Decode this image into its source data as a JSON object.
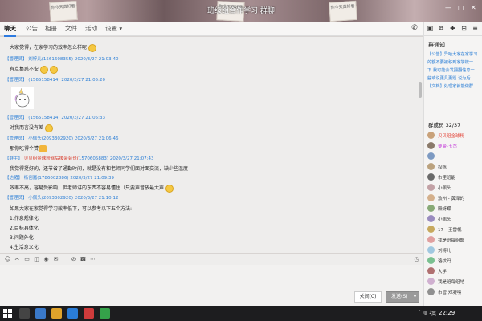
{
  "window": {
    "title": "班级组合作学习 群聊",
    "minimize": "—",
    "maximize": "□",
    "close": "✕"
  },
  "titlebar_notes": [
    "你今天真好看",
    "你今天真好看",
    "你今天真好看"
  ],
  "tabs": [
    {
      "label": "聊天"
    },
    {
      "label": "公告"
    },
    {
      "label": "相册"
    },
    {
      "label": "文件"
    },
    {
      "label": "活动"
    },
    {
      "label": "设置 ▾"
    }
  ],
  "messages": [
    {
      "text": "大家觉得，在家学习的效率怎么样呢"
    },
    {
      "role": "【管理员】",
      "user": "刘梓儿(",
      "qq": "1561608355",
      "close": ")",
      "time": "2020/3/27 21:03:40"
    },
    {
      "text": "有点集惑不安"
    },
    {
      "role": "【管理员】",
      "user": "(",
      "qq": "1565158414",
      "close": ")",
      "time": "2020/3/27 21:05:20"
    },
    {
      "role": "【管理员】",
      "user": "(",
      "qq": "1565158414",
      "close": ")",
      "time": "2020/3/27 21:05:33"
    },
    {
      "text": "对我而言没有差"
    },
    {
      "role": "【管理员】",
      "user": "小佩头(",
      "qq": "2093302920",
      "close": ")",
      "time": "2020/3/27 21:06:46"
    },
    {
      "text": "那你吃得个赞"
    },
    {
      "role": "【群主】",
      "user": "贝贝组金球粉丝后援会会长(",
      "qq": "1570605883",
      "close": ")",
      "time": "2020/3/27 21:07:43"
    },
    {
      "text": "我觉得挺好的，还节省了通勤时间，就是没有和老师同学们面对面交流，缺少些温度"
    },
    {
      "role": "【达猪】",
      "user": "杨创嘉(",
      "qq": "1786002886",
      "close": ")",
      "time": "2020/3/27 21:09:39"
    },
    {
      "text": "效率不高，容易受影响，但老师讲的东西不容易懂住（只要声音放最大声"
    },
    {
      "role": "【管理员】",
      "user": "小佩头(",
      "qq": "2093302920",
      "close": ")",
      "time": "2020/3/27 21:10:12"
    },
    {
      "text": "如果大家在家觉得学习效率低下，可以参考以下五个方法:"
    },
    {
      "text": "1.作息规律化"
    },
    {
      "text": "2.目标具体化"
    },
    {
      "text": "3.问题外化"
    },
    {
      "text": "4.生活意义化"
    }
  ],
  "input_toolbar": [
    "☺",
    "✂",
    "▭",
    "◫",
    "◉",
    "✉",
    "⊘",
    "☎",
    "⋯"
  ],
  "buttons": {
    "close": "关闭(C)",
    "send": "发送(S)",
    "send_arrow": "▾"
  },
  "right_panel": {
    "notice_title": "群通知",
    "notice_lines": [
      "【公告】异哈大家在家学习",
      "的额不要被移到家学校一",
      "下 我可能会发翻翻信息一",
      "些或说更具更题 说为后",
      "【文档】处理家就能做群"
    ],
    "members_title": "群成员 32/37",
    "members": [
      {
        "name": "贝贝组金球粉",
        "color": "#e23a2e",
        "avatar": "#c9a27a"
      },
      {
        "name": "萝曼-玉杰",
        "color": "#c238d8",
        "avatar": "#8a7a6a"
      },
      {
        "name": "",
        "color": "#333333",
        "avatar": "#7d9ac2"
      },
      {
        "name": "权帆",
        "color": "#333333",
        "avatar": "#bba27e"
      },
      {
        "name": "市里班能",
        "color": "#333333",
        "avatar": "#6a6a6a"
      },
      {
        "name": "小佩头",
        "color": "#333333",
        "avatar": "#c2a1a5"
      },
      {
        "name": "敖州 - 黄泽的",
        "color": "#333333",
        "avatar": "#d4b08c"
      },
      {
        "name": "殿蚜蝶",
        "color": "#333333",
        "avatar": "#88aa77"
      },
      {
        "name": "小佩头",
        "color": "#333333",
        "avatar": "#9a8cbf"
      },
      {
        "name": "17---王雷帆",
        "color": "#333333",
        "avatar": "#c7a95e"
      },
      {
        "name": "我是班每组邮",
        "color": "#333333",
        "avatar": "#e0a0a0"
      },
      {
        "name": "刘将儿",
        "color": "#333333",
        "avatar": "#a0c8e0"
      },
      {
        "name": "珞纹码",
        "color": "#333333",
        "avatar": "#7ac090"
      },
      {
        "name": "大学",
        "color": "#333333",
        "avatar": "#b07070"
      },
      {
        "name": "我是班每组地",
        "color": "#333333",
        "avatar": "#d0b0d0"
      },
      {
        "name": "市管 郑凝嘿",
        "color": "#333333",
        "avatar": "#909090"
      }
    ]
  },
  "taskbar": {
    "clock": "22:29",
    "tray_lang": "英"
  }
}
